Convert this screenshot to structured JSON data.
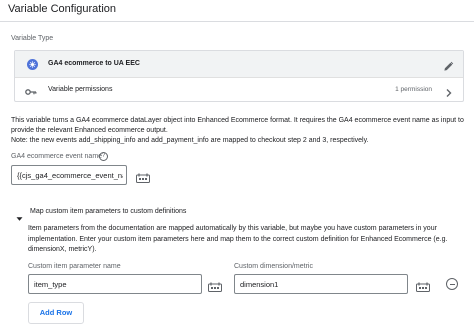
{
  "header": {
    "title": "Variable Configuration"
  },
  "variable_type": {
    "section_label": "Variable Type",
    "type_name": "GA4 ecommerce to UA EEC",
    "permissions_label": "Variable permissions",
    "permissions_count": "1 permission"
  },
  "description": {
    "line1": "This variable turns a GA4 ecommerce dataLayer object into Enhanced Ecommerce format. It requires the GA4 ecommerce event name as input to",
    "line2": "provide the relevant Enhanced ecommerce output.",
    "line3": "Note: the new events add_shipping_info and add_payment_info are mapped to checkout step 2 and 3, respectively."
  },
  "event_name_field": {
    "label": "GA4 ecommerce event name",
    "value": "{{cjs_ga4_ecommerce_event_nar"
  },
  "custom_params": {
    "title": "Map custom item parameters to custom definitions",
    "desc_line1": "Item parameters from the documentation are mapped automatically by this variable, but maybe you have custom parameters in your",
    "desc_line2": "implementation. Enter your custom item parameters here and map them to the correct custom definition for Enhanced Ecommerce (e.g.",
    "desc_line3": "dimensionX, metricY).",
    "col1_label": "Custom item parameter name",
    "col2_label": "Custom dimension/metric",
    "rows": [
      {
        "param": "item_type",
        "dimension": "dimension1"
      }
    ],
    "add_row_label": "Add Row"
  },
  "colors": {
    "accent": "#1a73e8",
    "type_icon": "#4f73d9",
    "header_bg": "#f1f3f4"
  }
}
